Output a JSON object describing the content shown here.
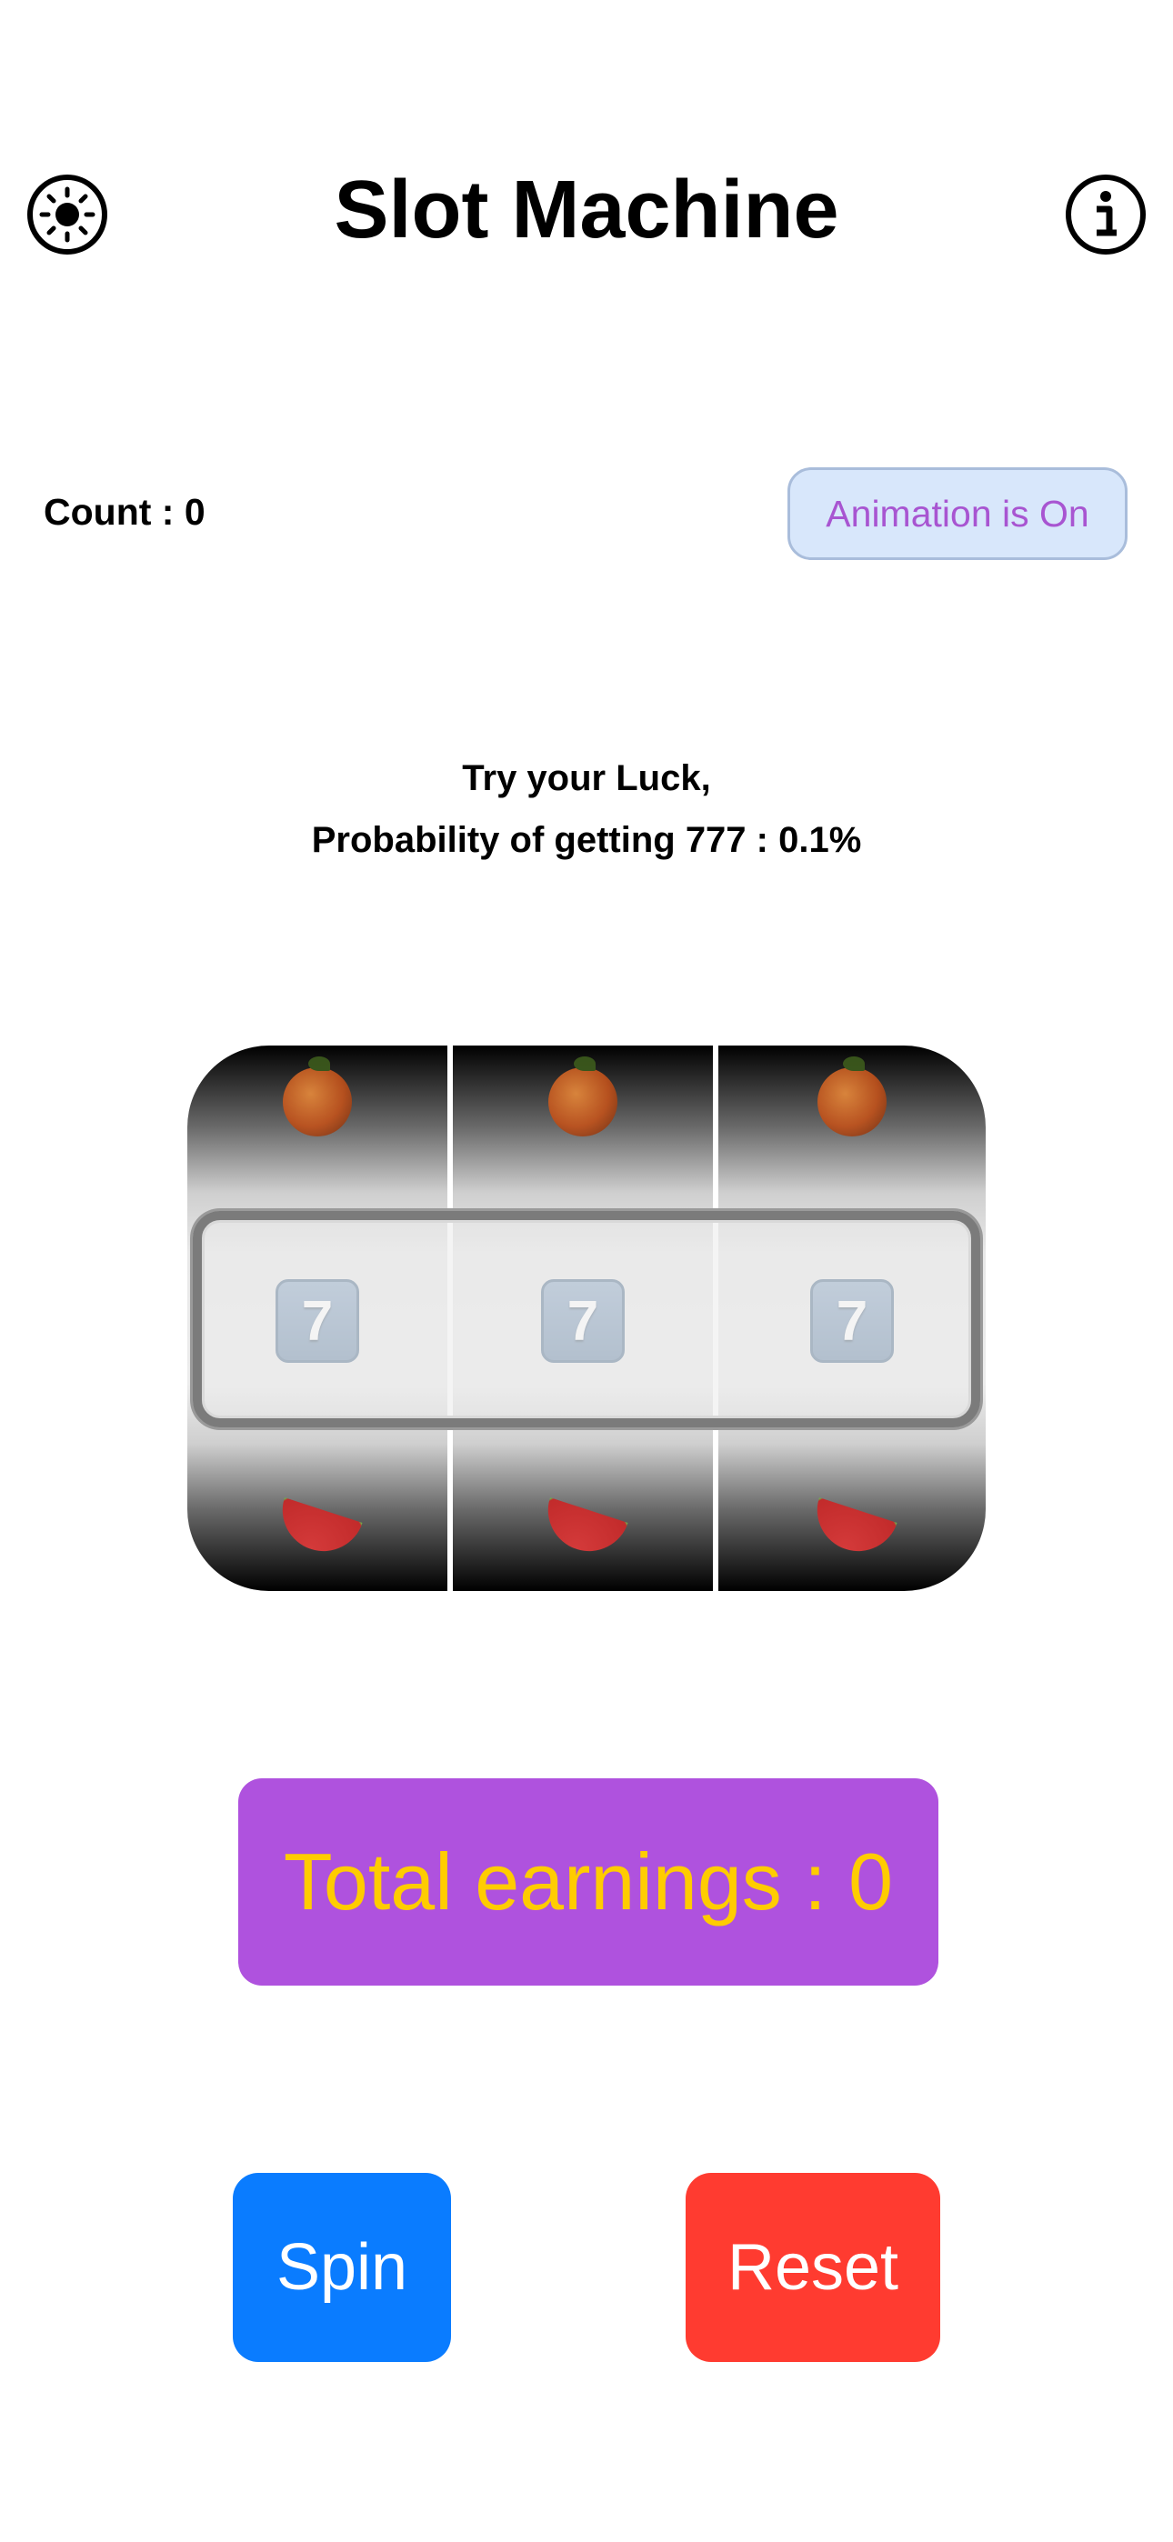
{
  "header": {
    "title": "Slot Machine",
    "left_icon": "brightness-icon",
    "right_icon": "info-icon"
  },
  "status": {
    "count_label": "Count : 0",
    "animation_button_label": "Animation is On"
  },
  "message": {
    "line1": "Try your Luck,",
    "line2": "Probability of getting 777 : 0.1%"
  },
  "slot": {
    "reels": [
      {
        "top": "orange-icon",
        "middle": "7",
        "bottom": "watermelon-icon"
      },
      {
        "top": "orange-icon",
        "middle": "7",
        "bottom": "watermelon-icon"
      },
      {
        "top": "orange-icon",
        "middle": "7",
        "bottom": "watermelon-icon"
      }
    ]
  },
  "earnings": {
    "label": "Total earnings : 0"
  },
  "actions": {
    "spin_label": "Spin",
    "reset_label": "Reset"
  },
  "colors": {
    "earnings_bg": "#af52de",
    "earnings_text": "#ffcc00",
    "spin_bg": "#0a7cff",
    "reset_bg": "#ff3b30",
    "animation_btn_bg": "#d8e7fb",
    "animation_btn_text": "#a855d1"
  }
}
